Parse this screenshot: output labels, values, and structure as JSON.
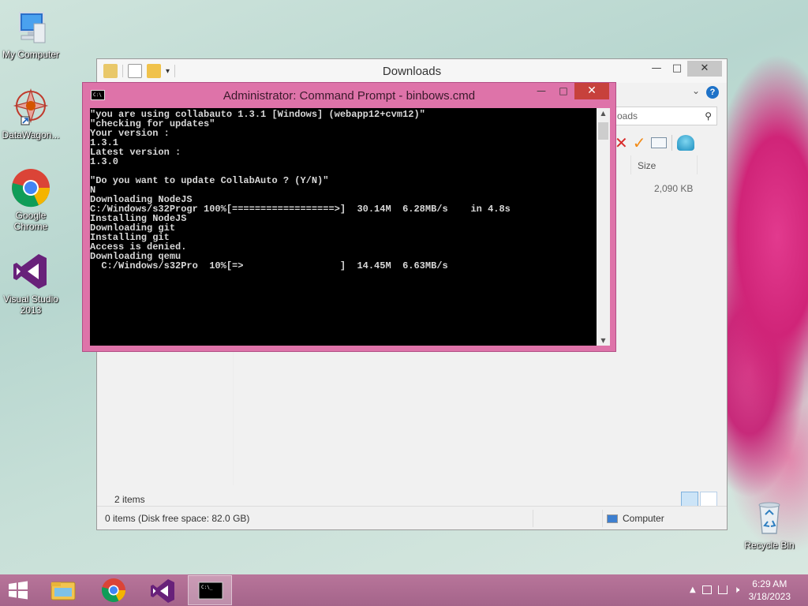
{
  "desktop": {
    "icons": [
      {
        "label": "My Computer"
      },
      {
        "label": "DataWagon..."
      },
      {
        "label": "Google Chrome"
      },
      {
        "label": "Visual Studio 2013"
      },
      {
        "label": "Recycle Bin"
      }
    ]
  },
  "explorer": {
    "title": "Downloads",
    "search_placeholder": "oads",
    "column_size": "Size",
    "file_size": "2,090 KB",
    "items_count": "2 items",
    "status_left": "0 items (Disk free space: 82.0 GB)",
    "status_right": "Computer"
  },
  "cmd": {
    "title": "Administrator:  Command Prompt - binbows.cmd",
    "lines": [
      "\"you are using collabauto 1.3.1 [Windows] (webapp12+cvm12)\"",
      "\"checking for updates\"",
      "Your version :",
      "1.3.1",
      "Latest version :",
      "1.3.0",
      "",
      "\"Do you want to update CollabAuto ? (Y/N)\"",
      "N",
      "Downloading NodeJS",
      "C:/Windows/s32Progr 100%[==================>]  30.14M  6.28MB/s    in 4.8s",
      "Installing NodeJS",
      "Downloading git",
      "Installing git",
      "Access is denied.",
      "Downloading qemu",
      "  C:/Windows/s32Pro  10%[=>                 ]  14.45M  6.63MB/s"
    ]
  },
  "taskbar": {
    "time": "6:29 AM",
    "date": "3/18/2023",
    "items": [
      "file-explorer",
      "google-chrome",
      "visual-studio",
      "command-prompt"
    ]
  }
}
